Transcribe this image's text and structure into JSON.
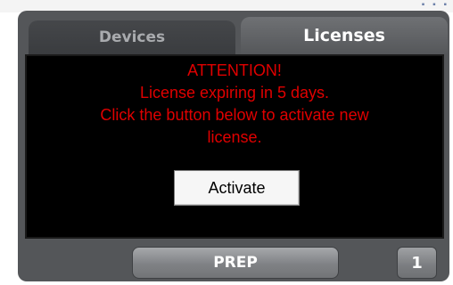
{
  "tabs": [
    {
      "label": "Devices",
      "active": false
    },
    {
      "label": "Licenses",
      "active": true
    }
  ],
  "license_notice": {
    "lines": [
      "ATTENTION!",
      "License expiring in 5 days.",
      "Click the button below to activate new",
      "license."
    ],
    "color": "#e00000"
  },
  "activate_button": {
    "label": "Activate"
  },
  "bottom_bar": {
    "prep_label": "PREP",
    "page_number": "1"
  },
  "colors": {
    "panel": "#545659",
    "content_background": "#000000",
    "active_tab_text": "#ffffff",
    "inactive_tab_text": "#a9abae"
  }
}
